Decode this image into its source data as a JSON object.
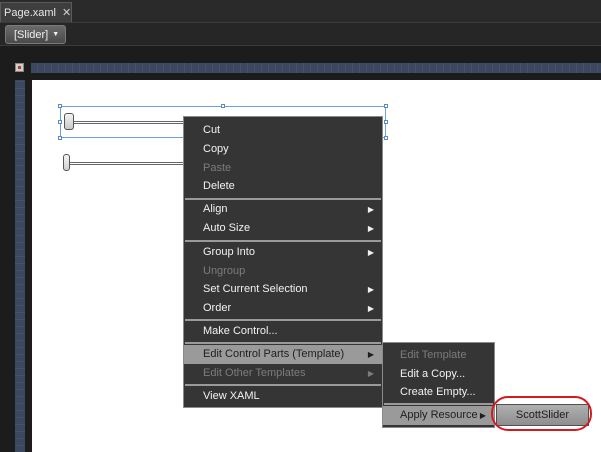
{
  "tabs": [
    {
      "label": "Page.xaml",
      "close": "✕"
    }
  ],
  "breadcrumb": {
    "label": "[Slider]",
    "arrow": "▼"
  },
  "context_menu": {
    "items": [
      {
        "label": "Cut",
        "enabled": true
      },
      {
        "label": "Copy",
        "enabled": true
      },
      {
        "label": "Paste",
        "enabled": false
      },
      {
        "label": "Delete",
        "enabled": true
      },
      {
        "label": "Align",
        "enabled": true,
        "submenu": true
      },
      {
        "label": "Auto Size",
        "enabled": true,
        "submenu": true
      },
      {
        "label": "Group Into",
        "enabled": true,
        "submenu": true
      },
      {
        "label": "Ungroup",
        "enabled": false
      },
      {
        "label": "Set Current Selection",
        "enabled": true,
        "submenu": true
      },
      {
        "label": "Order",
        "enabled": true,
        "submenu": true
      },
      {
        "label": "Make Control...",
        "enabled": true
      },
      {
        "label": "Edit Control Parts (Template)",
        "enabled": true,
        "submenu": true,
        "highlighted": true
      },
      {
        "label": "Edit Other Templates",
        "enabled": false,
        "submenu": true
      },
      {
        "label": "View XAML",
        "enabled": true
      }
    ],
    "submenu_arrow": "▶"
  },
  "template_submenu": {
    "items": [
      {
        "label": "Edit Template",
        "enabled": false
      },
      {
        "label": "Edit a Copy...",
        "enabled": true
      },
      {
        "label": "Create Empty...",
        "enabled": true
      },
      {
        "label": "Apply Resource",
        "enabled": true,
        "submenu": true,
        "highlighted": true
      }
    ]
  },
  "resource_submenu": {
    "items": [
      {
        "label": "ScottSlider"
      }
    ]
  },
  "colors": {
    "menu_bg": "#353535",
    "highlight": "#9a9a9a",
    "annotation_ring": "#d7191f",
    "selection": "#6ea0d8"
  }
}
